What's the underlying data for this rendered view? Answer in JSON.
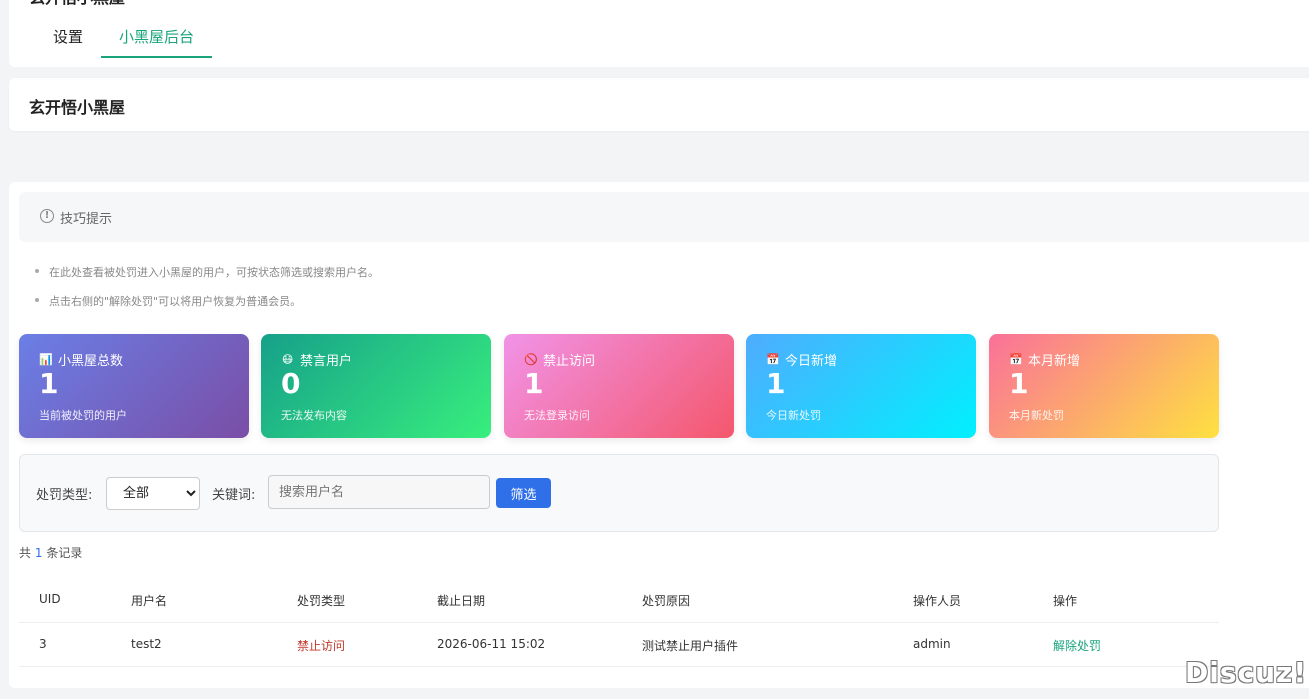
{
  "header": {
    "partial_title": "玄开悟小黑屋",
    "tabs": [
      {
        "label": "设置"
      },
      {
        "label": "小黑屋后台"
      }
    ]
  },
  "page_title": "玄开悟小黑屋",
  "tip": {
    "label": "技巧提示",
    "items": [
      "在此处查看被处罚进入小黑屋的用户，可按状态筛选或搜索用户名。",
      "点击右侧的\"解除处罚\"可以将用户恢复为普通会员。"
    ]
  },
  "stats": [
    {
      "icon": "📊",
      "icon_name": "bar-chart-icon",
      "title": "小黑屋总数",
      "value": "1",
      "sub": "当前被处罚的用户",
      "colors": [
        "#6a7fe6",
        "#7a4ea6"
      ]
    },
    {
      "icon": "😷",
      "icon_name": "mute-face-icon",
      "title": "禁言用户",
      "value": "0",
      "sub": "无法发布内容",
      "colors": [
        "#16a08a",
        "#38ef7d"
      ]
    },
    {
      "icon": "🚫",
      "icon_name": "prohibited-icon",
      "title": "禁止访问",
      "value": "1",
      "sub": "无法登录访问",
      "colors": [
        "#f193e8",
        "#f4576c"
      ]
    },
    {
      "icon": "📅",
      "icon_name": "calendar-icon",
      "title": "今日新增",
      "value": "1",
      "sub": "今日新处罚",
      "colors": [
        "#4facfe",
        "#00f0fe"
      ]
    },
    {
      "icon": "📅",
      "icon_name": "calendar-icon",
      "title": "本月新增",
      "value": "1",
      "sub": "本月新处罚",
      "colors": [
        "#fa709a",
        "#fee140"
      ]
    }
  ],
  "filter": {
    "type_label": "处罚类型:",
    "type_selected": "全部",
    "keyword_label": "关键词:",
    "keyword_placeholder": "搜索用户名",
    "keyword_value": "",
    "submit_label": "筛选"
  },
  "record_count": {
    "prefix": "共",
    "count": "1",
    "suffix": "条记录"
  },
  "table": {
    "headers": [
      "UID",
      "用户名",
      "处罚类型",
      "截止日期",
      "处罚原因",
      "操作人员",
      "操作"
    ],
    "rows": [
      {
        "uid": "3",
        "username": "test2",
        "type": "禁止访问",
        "end_date": "2026-06-11 15:02",
        "reason": "测试禁止用户插件",
        "operator": "admin",
        "action": "解除处罚"
      }
    ]
  },
  "watermark": "Discuz!",
  "colors": {
    "accent": "#1aa47b",
    "primary_button": "#2f6fe8",
    "danger_text": "#c0392b"
  }
}
